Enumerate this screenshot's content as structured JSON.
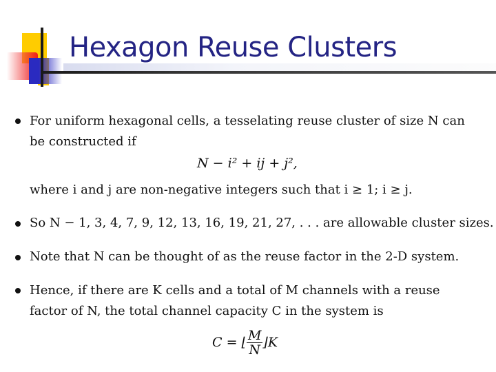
{
  "slide": {
    "title": "Hexagon Reuse Clusters",
    "title_color": "#242484",
    "bullets": [
      {
        "lines": [
          "For uniform hexagonal cells, a tesselating reuse cluster of size N can",
          "be constructed if"
        ],
        "equation": "N − i² + ij + j²,",
        "after": "where i and j are non-negative integers such that i ≥ 1; i ≥ j."
      },
      {
        "lines": [
          "So N − 1, 3, 4, 7, 9, 12, 13, 16, 19, 21, 27, . . . are allowable cluster sizes."
        ]
      },
      {
        "lines": [
          "Note that N can be thought of as the reuse factor in the 2-D system."
        ]
      },
      {
        "lines": [
          "Hence, if there are K cells and a total of M channels with a reuse",
          "factor of N, the total channel capacity C in the system is"
        ],
        "equation": {
          "lhs": "C = ⌊",
          "numerator": "M",
          "denominator": "N",
          "rhs": "⌋K"
        }
      }
    ]
  }
}
